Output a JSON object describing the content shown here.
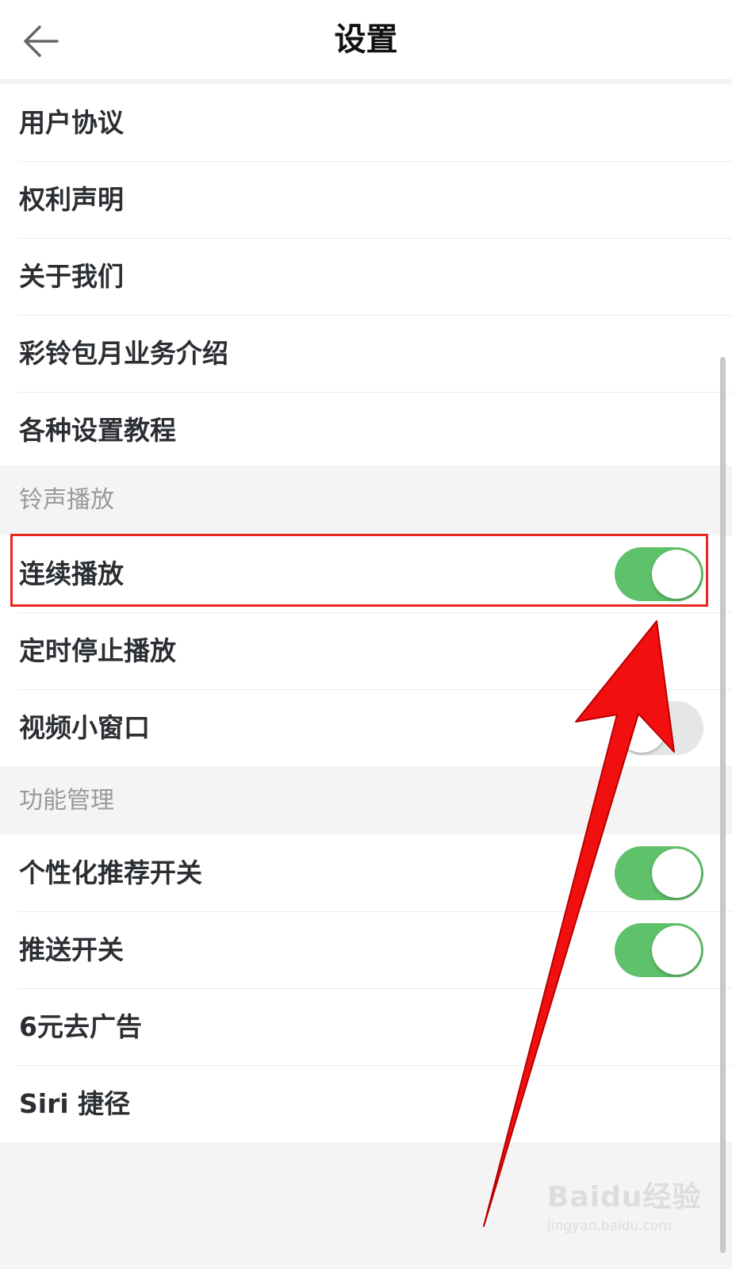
{
  "header": {
    "title": "设置",
    "back_icon": "arrow-left-icon"
  },
  "group_top": {
    "items": [
      "用户协议",
      "权利声明",
      "关于我们",
      "彩铃包月业务介绍",
      "各种设置教程"
    ]
  },
  "section_ringtone": {
    "title": "铃声播放",
    "continuous_play": {
      "label": "连续播放",
      "on": true
    },
    "timer_stop": {
      "label": "定时停止播放"
    },
    "video_mini_window": {
      "label": "视频小窗口",
      "on": false
    }
  },
  "section_features": {
    "title": "功能管理",
    "personalized": {
      "label": "个性化推荐开关",
      "on": true
    },
    "push": {
      "label": "推送开关",
      "on": true
    },
    "remove_ads": {
      "label": "6元去广告"
    },
    "siri": {
      "label": "Siri 捷径"
    }
  },
  "watermark": {
    "brand": "Baidu经验",
    "url": "jingyan.baidu.com"
  },
  "colors": {
    "toggle_on": "#5fc16a",
    "toggle_off": "#e6e6e6",
    "highlight": "#e8271f",
    "arrow": "#f20f0f"
  }
}
